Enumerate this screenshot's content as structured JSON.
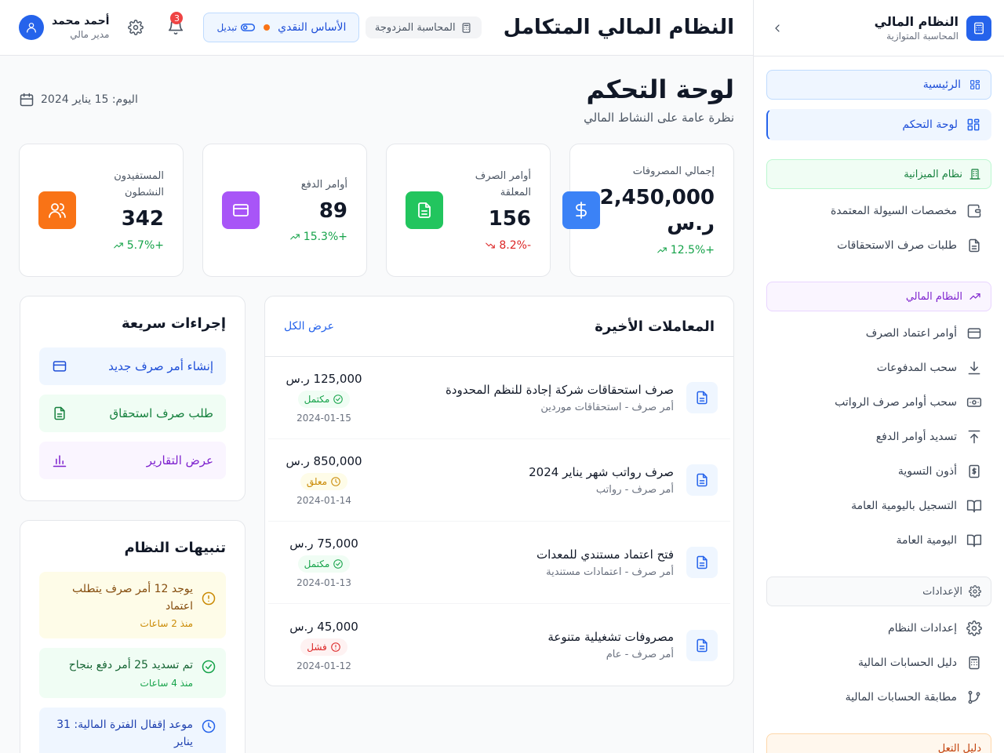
{
  "sidebar": {
    "title": "النظام المالي",
    "subtitle": "المحاسبة المتوازية",
    "home": "الرئيسية",
    "active": "لوحة التحكم",
    "sections": [
      {
        "label": "نظام الميزانية",
        "items": [
          "مخصصات السيولة المعتمدة",
          "طلبات صرف الاستحقاقات"
        ]
      },
      {
        "label": "النظام المالي",
        "items": [
          "أوامر اعتماد الصرف",
          "سحب المدفوعات",
          "سحب أوامر صرف الرواتب",
          "تسديد أوامر الدفع",
          "أذون التسوية",
          "التسجيل باليومية العامة",
          "اليومية العامة"
        ]
      },
      {
        "label": "الإعدادات",
        "items": [
          "إعدادات النظام",
          "دليل الحسابات المالية",
          "مطابقة الحسابات المالية"
        ]
      },
      {
        "label": "دليل التعل"
      }
    ]
  },
  "topbar": {
    "title": "النظام المالي المتكامل",
    "tag": "المحاسبة المزدوجة",
    "basis_label": "الأساس النقدي",
    "basis_toggle": "تبديل",
    "notifications": "3",
    "user_name": "أحمد محمد",
    "user_role": "مدير مالي"
  },
  "page": {
    "title": "لوحة التحكم",
    "subtitle": "نظرة عامة على النشاط المالي",
    "today": "اليوم: 15 يناير 2024"
  },
  "stats": [
    {
      "label": "إجمالي المصروفات",
      "value": "2,450,000 ر.س",
      "change": "+12.5%",
      "trend": "up",
      "color": "#3b82f6",
      "icon": "dollar-icon"
    },
    {
      "label": "أوامر الصرف المعلقة",
      "value": "156",
      "change": "-8.2%",
      "trend": "down",
      "color": "#22c55e",
      "icon": "document-icon"
    },
    {
      "label": "أوامر الدفع",
      "value": "89",
      "change": "+15.3%",
      "trend": "up",
      "color": "#a855f7",
      "icon": "card-icon"
    },
    {
      "label": "المستفيدون النشطون",
      "value": "342",
      "change": "+5.7%",
      "trend": "up",
      "color": "#f97316",
      "icon": "users-icon"
    }
  ],
  "transactions": {
    "title": "المعاملات الأخيرة",
    "view_all": "عرض الكل",
    "rows": [
      {
        "name": "صرف استحقاقات شركة إجادة للنظم المحدودة",
        "type": "أمر صرف - استحقاقات موردين",
        "amount": "125,000 ر.س",
        "status": "مكتمل",
        "state": "done",
        "date": "2024-01-15"
      },
      {
        "name": "صرف رواتب شهر يناير 2024",
        "type": "أمر صرف - رواتب",
        "amount": "850,000 ر.س",
        "status": "معلق",
        "state": "pend",
        "date": "2024-01-14"
      },
      {
        "name": "فتح اعتماد مستندي للمعدات",
        "type": "أمر صرف - اعتمادات مستندية",
        "amount": "75,000 ر.س",
        "status": "مكتمل",
        "state": "done",
        "date": "2024-01-13"
      },
      {
        "name": "مصروفات تشغيلية متنوعة",
        "type": "أمر صرف - عام",
        "amount": "45,000 ر.س",
        "status": "فشل",
        "state": "fail",
        "date": "2024-01-12"
      }
    ]
  },
  "quick_actions": {
    "title": "إجراءات سريعة",
    "items": [
      "إنشاء أمر صرف جديد",
      "طلب صرف استحقاق",
      "عرض التقارير"
    ]
  },
  "alerts": {
    "title": "تنبيهات النظام",
    "items": [
      {
        "text": "يوجد 12 أمر صرف يتطلب اعتماد",
        "time": "منذ 2 ساعات"
      },
      {
        "text": "تم تسديد 25 أمر دفع بنجاح",
        "time": "منذ 4 ساعات"
      },
      {
        "text": "موعد إقفال الفترة المالية: 31 يناير",
        "time": ""
      }
    ]
  }
}
